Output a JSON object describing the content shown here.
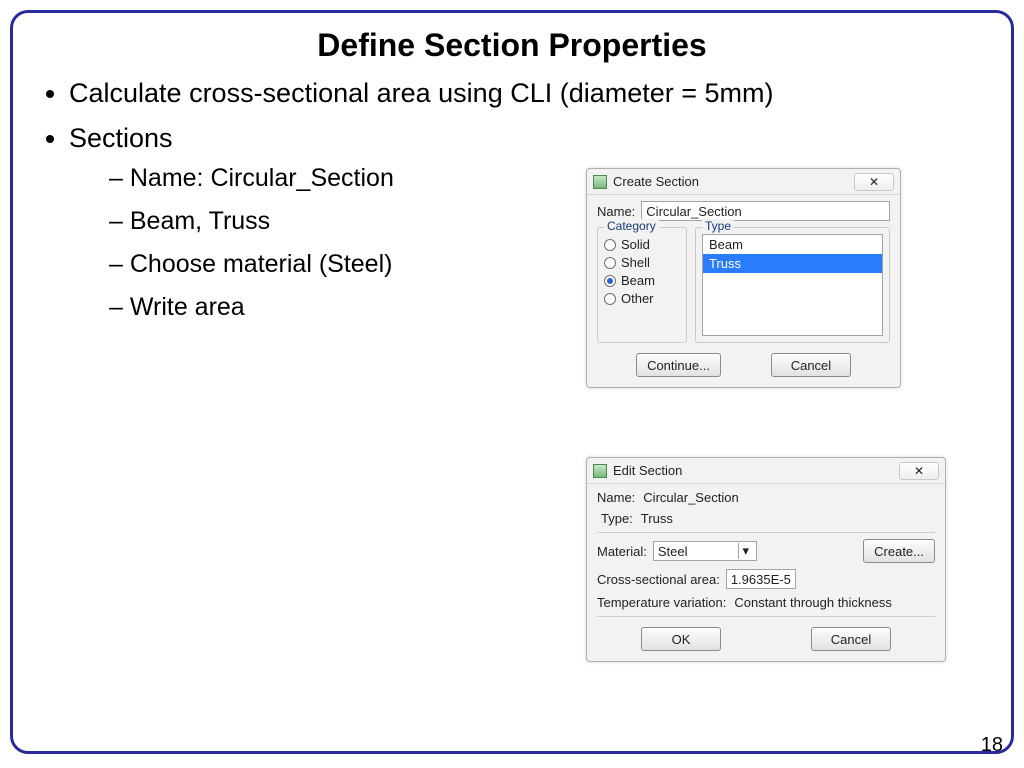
{
  "slide": {
    "title": "Define Section Properties",
    "page_no": "18",
    "bullets": {
      "b1": "Calculate cross-sectional area using CLI (diameter = 5mm)",
      "b2": "Sections",
      "sub": {
        "s1": "Name: Circular_Section",
        "s2": "Beam, Truss",
        "s3": "Choose material (Steel)",
        "s4": "Write area"
      }
    }
  },
  "createDlg": {
    "title": "Create Section",
    "name_label": "Name:",
    "name_value": "Circular_Section",
    "category_legend": "Category",
    "type_legend": "Type",
    "category_options": {
      "solid": "Solid",
      "shell": "Shell",
      "beam": "Beam",
      "other": "Other"
    },
    "type_options": {
      "beam": "Beam",
      "truss": "Truss"
    },
    "continue_btn": "Continue...",
    "cancel_btn": "Cancel"
  },
  "editDlg": {
    "title": "Edit Section",
    "name_label": "Name:",
    "name_value": "Circular_Section",
    "type_label": "Type:",
    "type_value": "Truss",
    "material_label": "Material:",
    "material_value": "Steel",
    "create_btn": "Create...",
    "csa_label": "Cross-sectional area:",
    "csa_value": "1.9635E-5",
    "temp_label": "Temperature variation:",
    "temp_value": "Constant through thickness",
    "ok_btn": "OK",
    "cancel_btn": "Cancel"
  }
}
